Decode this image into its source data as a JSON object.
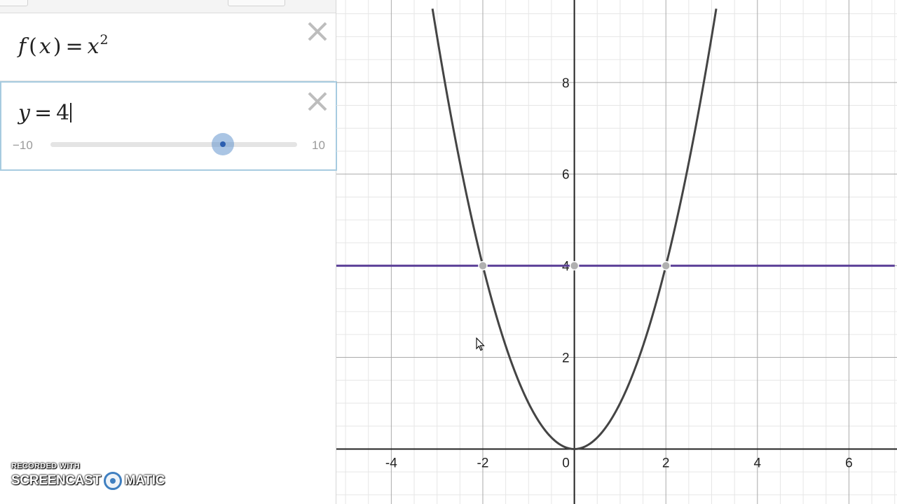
{
  "expressions": [
    {
      "lhs": "f",
      "arg": "x",
      "rhs_base": "x",
      "rhs_exp": "2"
    },
    {
      "lhs": "y",
      "rhs": "4",
      "slider": {
        "min": "−10",
        "max": "10",
        "value": 4
      }
    }
  ],
  "graph": {
    "x_ticks": [
      "-4",
      "-2",
      "0",
      "2",
      "4",
      "6"
    ],
    "y_ticks": [
      "2",
      "4",
      "6",
      "8"
    ],
    "curve_color": "#444444",
    "line_color": "#5b3f97"
  },
  "chart_data": {
    "type": "line",
    "series": [
      {
        "expression": "x^2",
        "x": [
          -3.1,
          -2.5,
          -2,
          -1.5,
          -1,
          -0.5,
          0,
          0.5,
          1,
          1.5,
          2,
          2.5,
          3.1
        ],
        "y": [
          9.61,
          6.25,
          4,
          2.25,
          1,
          0.25,
          0,
          0.25,
          1,
          2.25,
          4,
          6.25,
          9.61
        ]
      },
      {
        "expression": "y = 4",
        "x": [
          -5.2,
          7
        ],
        "y": [
          4,
          4
        ]
      }
    ],
    "points": [
      {
        "x": -2,
        "y": 4
      },
      {
        "x": 0,
        "y": 4
      },
      {
        "x": 2,
        "y": 4
      }
    ],
    "xlim": [
      -5.2,
      7.05
    ],
    "ylim": [
      -1.2,
      9.8
    ],
    "grid": true
  },
  "watermark": {
    "line1": "RECORDED WITH",
    "line2a": "SCREENCAST",
    "line2b": "MATIC"
  }
}
